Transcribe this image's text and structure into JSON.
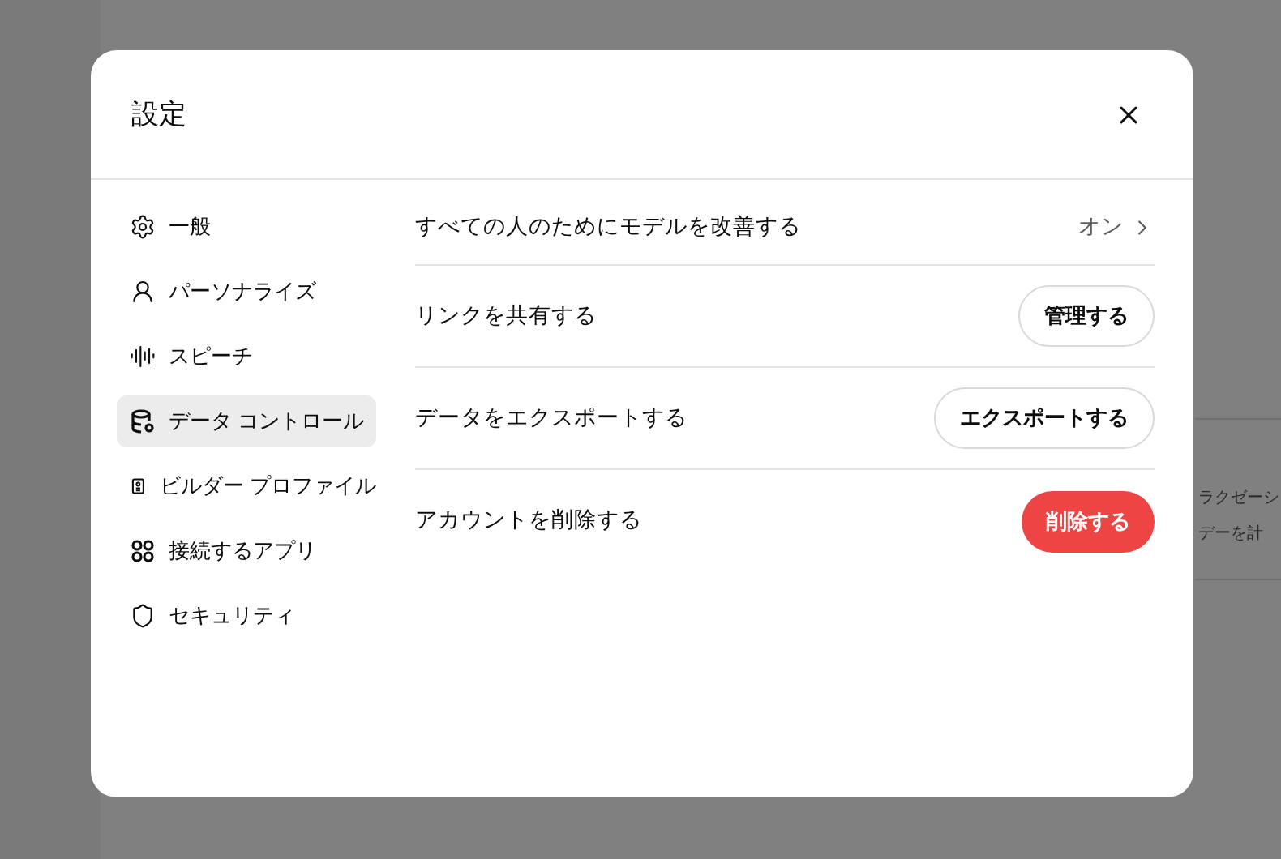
{
  "background": {
    "card_lines": [
      "ラクゼーシ",
      "デーを計"
    ]
  },
  "dialog": {
    "title": "設定"
  },
  "sidebar": {
    "items": [
      {
        "label": "一般",
        "selected": false
      },
      {
        "label": "パーソナライズ",
        "selected": false
      },
      {
        "label": "スピーチ",
        "selected": false
      },
      {
        "label": "データ コントロール",
        "selected": true
      },
      {
        "label": "ビルダー プロファイル",
        "selected": false
      },
      {
        "label": "接続するアプリ",
        "selected": false
      },
      {
        "label": "セキュリティ",
        "selected": false
      }
    ]
  },
  "settings": [
    {
      "kind": "link",
      "label": "すべての人のためにモデルを改善する",
      "value": "オン"
    },
    {
      "kind": "button",
      "label": "リンクを共有する",
      "action": "管理する"
    },
    {
      "kind": "button",
      "label": "データをエクスポートする",
      "action": "エクスポートする"
    },
    {
      "kind": "danger",
      "label": "アカウントを削除する",
      "action": "削除する"
    }
  ]
}
